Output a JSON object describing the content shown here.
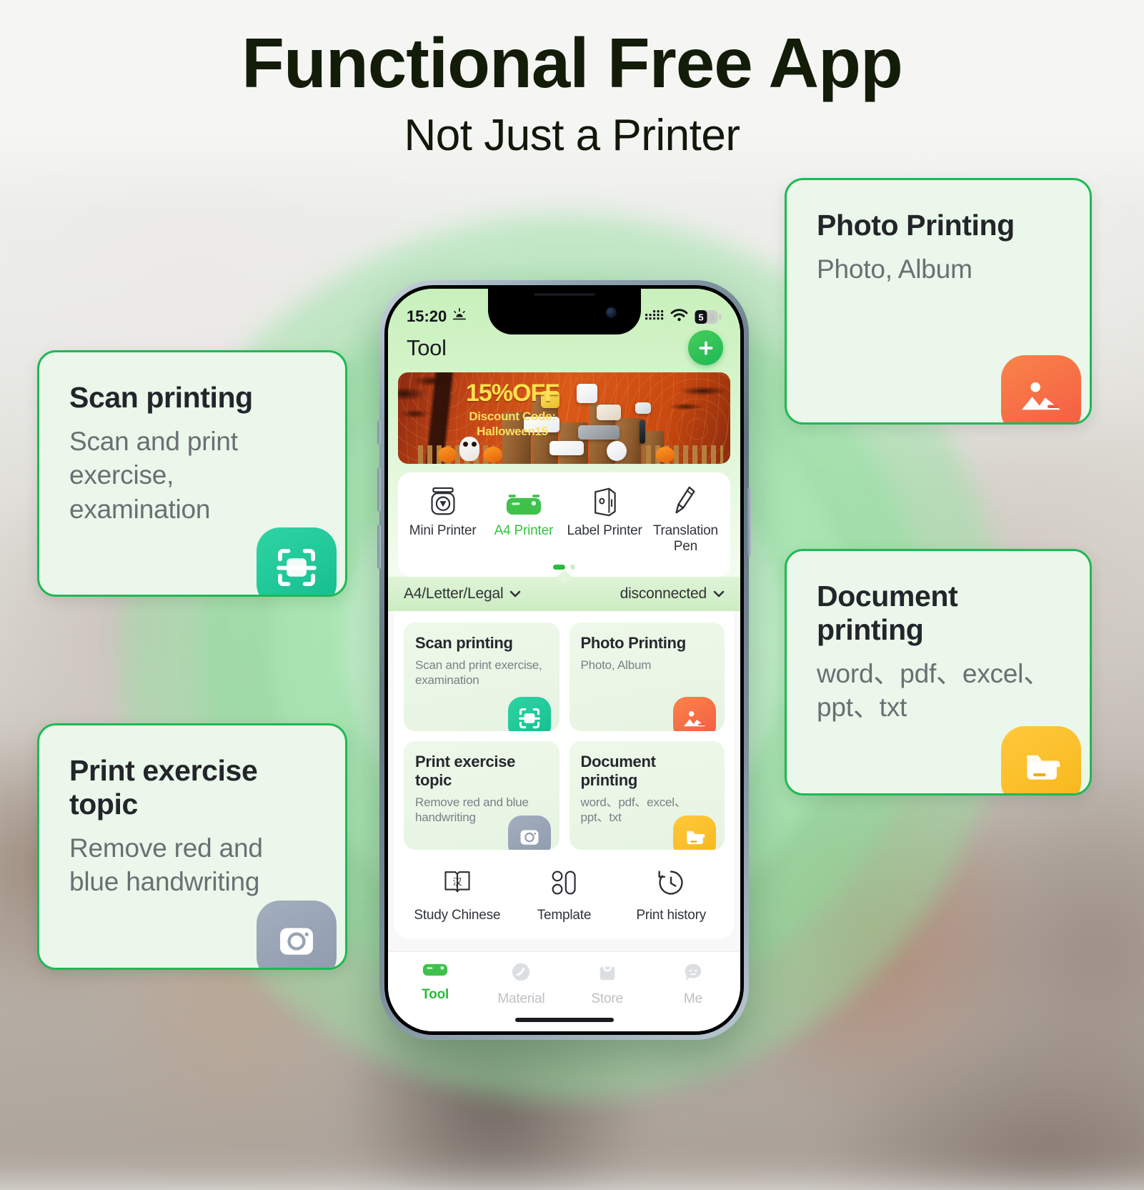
{
  "hero": {
    "headline": "Functional Free App",
    "subheadline": "Not Just a Printer",
    "headline_color": "#131c08"
  },
  "theme": {
    "accent_green": "#1db954",
    "card_bg": "#eaf7ea",
    "card_border": "#1db954",
    "tab_active": "#34c23f"
  },
  "callouts": [
    {
      "id": "scan-printing",
      "title": "Scan printing",
      "subtitle": "Scan and print exercise, examination",
      "icon": "scan-icon",
      "icon_color": "#14bd8e"
    },
    {
      "id": "print-exercise-topic",
      "title": "Print exercise topic",
      "subtitle": "Remove red and blue handwriting",
      "icon": "camera-icon",
      "icon_color": "#8e9bad"
    },
    {
      "id": "photo-printing",
      "title": "Photo Printing",
      "subtitle": "Photo, Album",
      "icon": "image-icon",
      "icon_color": "#f45b43"
    },
    {
      "id": "document-printing",
      "title": "Document printing",
      "subtitle": "word、pdf、excel、ppt、txt",
      "icon": "folder-icon",
      "icon_color": "#f7b71b"
    }
  ],
  "phone": {
    "statusbar": {
      "time": "15:20",
      "weather_icon": "sunrise-icon",
      "signal_icon": "cellular-bars-icon",
      "wifi_icon": "wifi-icon",
      "battery_text": "50",
      "battery_icon": "battery-icon"
    },
    "header": {
      "title": "Tool",
      "add_label": "+"
    },
    "banner": {
      "discount": "15%OFF",
      "code_label": "Discount Code:",
      "code_value": "Halloween15"
    },
    "printer_types": [
      {
        "label": "Mini Printer",
        "icon": "mini-printer-icon",
        "active": false
      },
      {
        "label": "A4 Printer",
        "icon": "a4-printer-icon",
        "active": true
      },
      {
        "label": "Label Printer",
        "icon": "label-printer-icon",
        "active": false
      },
      {
        "label": "Translation Pen",
        "icon": "translation-pen-icon",
        "active": false
      }
    ],
    "selector": {
      "paper_size": "A4/Letter/Legal",
      "paper_chevron": "chevron-down-icon",
      "connection_status": "disconnected",
      "status_chevron": "chevron-down-icon"
    },
    "features": [
      {
        "title": "Scan printing",
        "subtitle": "Scan and print exercise, examination",
        "icon": "scan-icon"
      },
      {
        "title": "Photo Printing",
        "subtitle": "Photo, Album",
        "icon": "image-icon"
      },
      {
        "title": "Print exercise topic",
        "subtitle": "Remove red and blue handwriting",
        "icon": "camera-icon"
      },
      {
        "title": "Document printing",
        "subtitle": "word、pdf、excel、ppt、txt",
        "icon": "folder-icon"
      }
    ],
    "tools": [
      {
        "label": "Study Chinese",
        "icon": "study-chinese-icon",
        "glyph": "汉"
      },
      {
        "label": "Template",
        "icon": "template-icon"
      },
      {
        "label": "Print history",
        "icon": "history-clock-icon"
      }
    ],
    "tabbar": [
      {
        "label": "Tool",
        "icon": "printer-icon",
        "active": true
      },
      {
        "label": "Material",
        "icon": "material-icon",
        "active": false
      },
      {
        "label": "Store",
        "icon": "store-bag-icon",
        "active": false
      },
      {
        "label": "Me",
        "icon": "profile-icon",
        "active": false
      }
    ]
  }
}
